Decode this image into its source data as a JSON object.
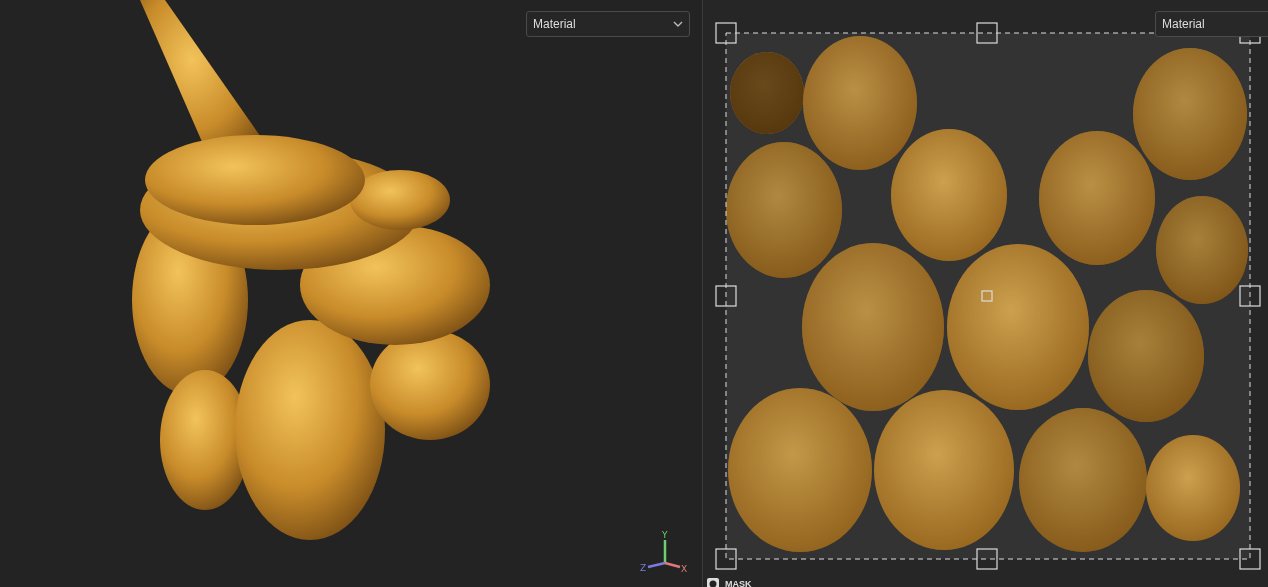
{
  "viewport_3d": {
    "channel_dropdown": "Material",
    "axis_gizmo": {
      "y_label": "Y",
      "z_label": "Z",
      "x_label": "X"
    }
  },
  "viewport_uv": {
    "channel_dropdown": "Material"
  },
  "bottom_panel": {
    "title": "MASK"
  }
}
